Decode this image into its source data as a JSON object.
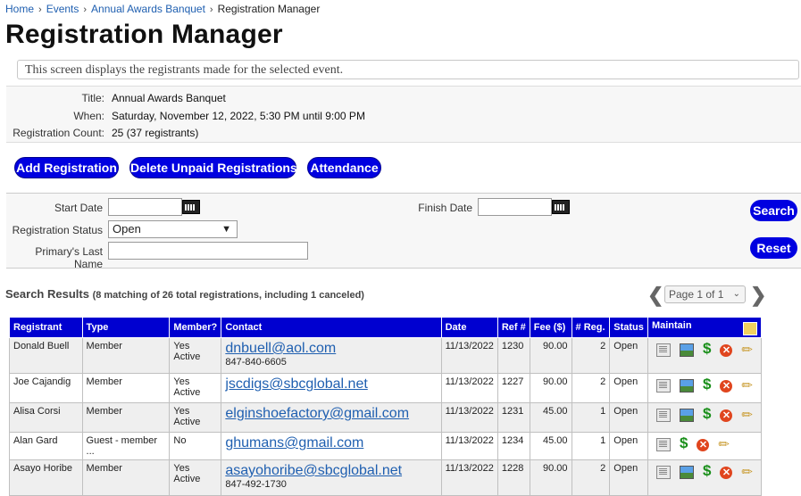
{
  "breadcrumb": {
    "items": [
      "Home",
      "Events",
      "Annual Awards Banquet"
    ],
    "current": "Registration Manager"
  },
  "page_title": "Registration Manager",
  "description": "This screen displays the registrants made for the selected event.",
  "info": {
    "title_label": "Title:",
    "title_value": "Annual Awards Banquet",
    "when_label": "When:",
    "when_value": "Saturday, November 12, 2022, 5:30 PM until 9:00 PM",
    "count_label": "Registration Count:",
    "count_value": "25 (37 registrants)"
  },
  "actions": {
    "add": "Add Registration",
    "delete_unpaid": "Delete Unpaid Registrations",
    "attendance": "Attendance"
  },
  "filters": {
    "start_date_label": "Start Date",
    "start_date_value": "",
    "finish_date_label": "Finish Date",
    "finish_date_value": "",
    "status_label": "Registration Status",
    "status_value": "Open",
    "last_name_label": "Primary's Last Name",
    "last_name_value": "",
    "search": "Search",
    "reset": "Reset"
  },
  "results": {
    "title": "Search Results",
    "summary": "(8 matching of 26 total registrations, including 1 canceled)",
    "pager": "Page 1 of 1"
  },
  "table": {
    "headers": [
      "Registrant",
      "Type",
      "Member?",
      "Contact",
      "Date",
      "Ref #",
      "Fee ($)",
      "# Reg.",
      "Status",
      "Maintain"
    ],
    "rows": [
      {
        "registrant": "Donald Buell",
        "type": "Member",
        "member1": "Yes",
        "member2": "Active",
        "email": "dnbuell@aol.com",
        "phone": "847-840-6605",
        "date": "11/13/2022",
        "ref": "1230",
        "fee": "90.00",
        "reg": "2",
        "status": "Open"
      },
      {
        "registrant": "Joe Cajandig",
        "type": "Member",
        "member1": "Yes",
        "member2": "Active",
        "email": "jscdigs@sbcglobal.net",
        "phone": "",
        "date": "11/13/2022",
        "ref": "1227",
        "fee": "90.00",
        "reg": "2",
        "status": "Open"
      },
      {
        "registrant": "Alisa Corsi",
        "type": "Member",
        "member1": "Yes",
        "member2": "Active",
        "email": "elginshoefactory@gmail.com",
        "phone": "",
        "date": "11/13/2022",
        "ref": "1231",
        "fee": "45.00",
        "reg": "1",
        "status": "Open"
      },
      {
        "registrant": "Alan Gard",
        "type": "Guest - member ...",
        "member1": "No",
        "member2": "",
        "email": "ghumans@gmail.com",
        "phone": "",
        "date": "11/13/2022",
        "ref": "1234",
        "fee": "45.00",
        "reg": "1",
        "status": "Open"
      },
      {
        "registrant": "Asayo Horibe",
        "type": "Member",
        "member1": "Yes",
        "member2": "Active",
        "email": "asayohoribe@sbcglobal.net",
        "phone": "847-492-1730",
        "date": "11/13/2022",
        "ref": "1228",
        "fee": "90.00",
        "reg": "2",
        "status": "Open"
      }
    ]
  },
  "icons": {
    "breadcrumb_sep": "chevron-right-icon",
    "calendar": "calendar-icon",
    "pager_prev": "chevron-left-icon",
    "pager_next": "chevron-right-icon",
    "export": "export-icon",
    "view": "view-details-icon",
    "photo": "photo-icon",
    "payment": "dollar-icon",
    "delete": "delete-icon",
    "edit": "pencil-icon"
  },
  "colors": {
    "accent": "#0000e0",
    "link": "#1f5fb0",
    "delete": "#e0451e",
    "payment": "#1a8f1a"
  }
}
